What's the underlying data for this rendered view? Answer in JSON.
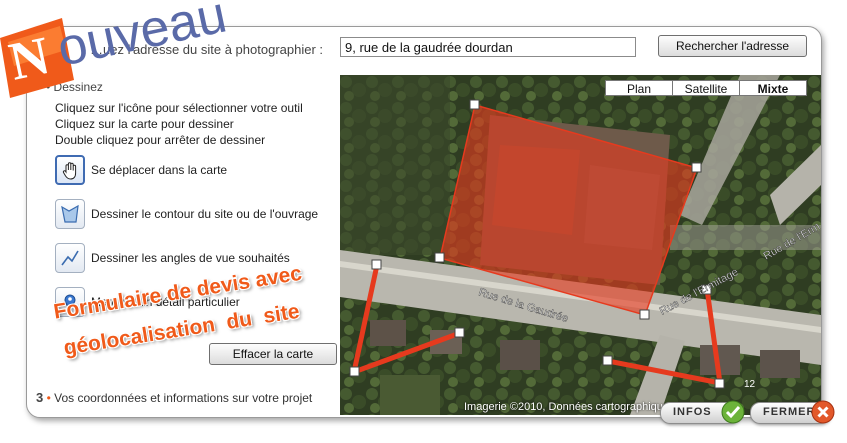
{
  "logo": {
    "text": "Nouveau",
    "brand_color": "#f05a1a"
  },
  "address": {
    "label": "…uez l'adresse du site à photographier :",
    "value": "9, rue de la gaudrée dourdan",
    "search_button": "Rechercher l'adresse"
  },
  "draw_step": {
    "title": "Dessinez",
    "instructions": [
      "Cliquez sur l'icône pour sélectionner votre outil",
      "Cliquez sur la carte pour dessiner",
      "Double cliquez pour arrêter de dessiner"
    ],
    "tools": [
      {
        "icon": "hand-icon",
        "label": "Se déplacer dans la carte",
        "active": true
      },
      {
        "icon": "polygon-icon",
        "label": "Dessiner le contour du site ou de l'ouvrage",
        "active": false
      },
      {
        "icon": "polyline-icon",
        "label": "Dessiner les angles de vue souhaités",
        "active": false
      },
      {
        "icon": "pin-icon",
        "label": "Marquer un détail particulier",
        "active": false
      }
    ],
    "clear_button": "Effacer la carte"
  },
  "promo": {
    "line1": "Formulaire de devis avec",
    "line2": "géolocalisation du site"
  },
  "next_step": {
    "number": "3",
    "label": "Vos coordonnées et informations sur votre projet"
  },
  "map": {
    "tabs": [
      "Plan",
      "Satellite",
      "Mixte"
    ],
    "active_tab": "Mixte",
    "street_labels": [
      "Rue de la Gaudrée",
      "Rue de l'Ermitage",
      "Rue de l'Erm",
      "12"
    ],
    "credit": "Imagerie ©2010, Données cartographiques",
    "polygon_color": "#e63a1e"
  },
  "bottom": {
    "infos": "INFOS",
    "fermer": "FERMER"
  }
}
